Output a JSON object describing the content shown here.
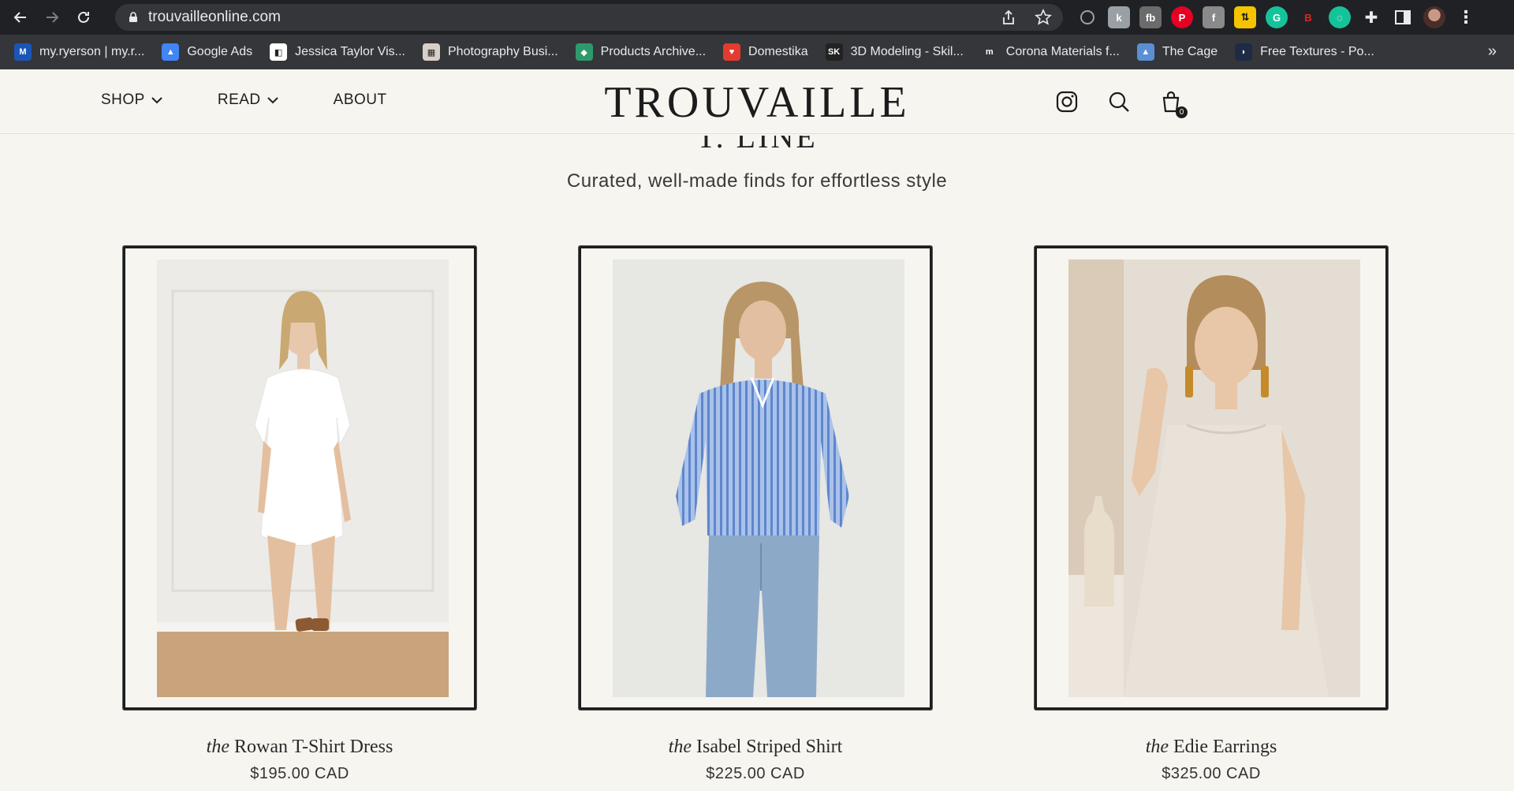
{
  "browser": {
    "url": "trouvailleonline.com",
    "bookmarks": [
      {
        "label": "my.ryerson | my.r...",
        "icon": "ryerson-icon",
        "color": "#1a56b8",
        "glyph": "M"
      },
      {
        "label": "Google Ads",
        "icon": "google-ads-icon",
        "color": "#4285f4",
        "glyph": "▲"
      },
      {
        "label": "Jessica Taylor Vis...",
        "icon": "jt-icon",
        "color": "#ffffff",
        "glyph": "◧"
      },
      {
        "label": "Photography Busi...",
        "icon": "photo-busi-icon",
        "color": "#d8cfc8",
        "glyph": "▦"
      },
      {
        "label": "Products Archive...",
        "icon": "products-icon",
        "color": "#2e9a6b",
        "glyph": "◆"
      },
      {
        "label": "Domestika",
        "icon": "domestika-icon",
        "color": "#e33b2f",
        "glyph": "♥"
      },
      {
        "label": "3D Modeling - Skil...",
        "icon": "skill-icon",
        "color": "#222222",
        "glyph": "SK"
      },
      {
        "label": "Corona Materials f...",
        "icon": "corona-icon",
        "color": "#35363a",
        "glyph": "m"
      },
      {
        "label": "The Cage",
        "icon": "cage-icon",
        "color": "#5a8fd4",
        "glyph": "▲"
      },
      {
        "label": "Free Textures - Po...",
        "icon": "textures-icon",
        "color": "#1e2b44",
        "glyph": "◗"
      }
    ],
    "more": "»"
  },
  "header": {
    "logo": "TROUVAILLE",
    "menu": [
      {
        "label": "SHOP",
        "dropdown": true
      },
      {
        "label": "READ",
        "dropdown": true
      },
      {
        "label": "ABOUT",
        "dropdown": false
      }
    ],
    "cart_count": "0"
  },
  "section": {
    "title": "T. LINE",
    "subtitle": "Curated, well-made finds for effortless style"
  },
  "products": [
    {
      "prefix": "the",
      "name": "Rowan T-Shirt Dress",
      "price": "$195.00 CAD"
    },
    {
      "prefix": "the",
      "name": "Isabel Striped Shirt",
      "price": "$225.00 CAD"
    },
    {
      "prefix": "the",
      "name": "Edie Earrings",
      "price": "$325.00 CAD"
    }
  ]
}
